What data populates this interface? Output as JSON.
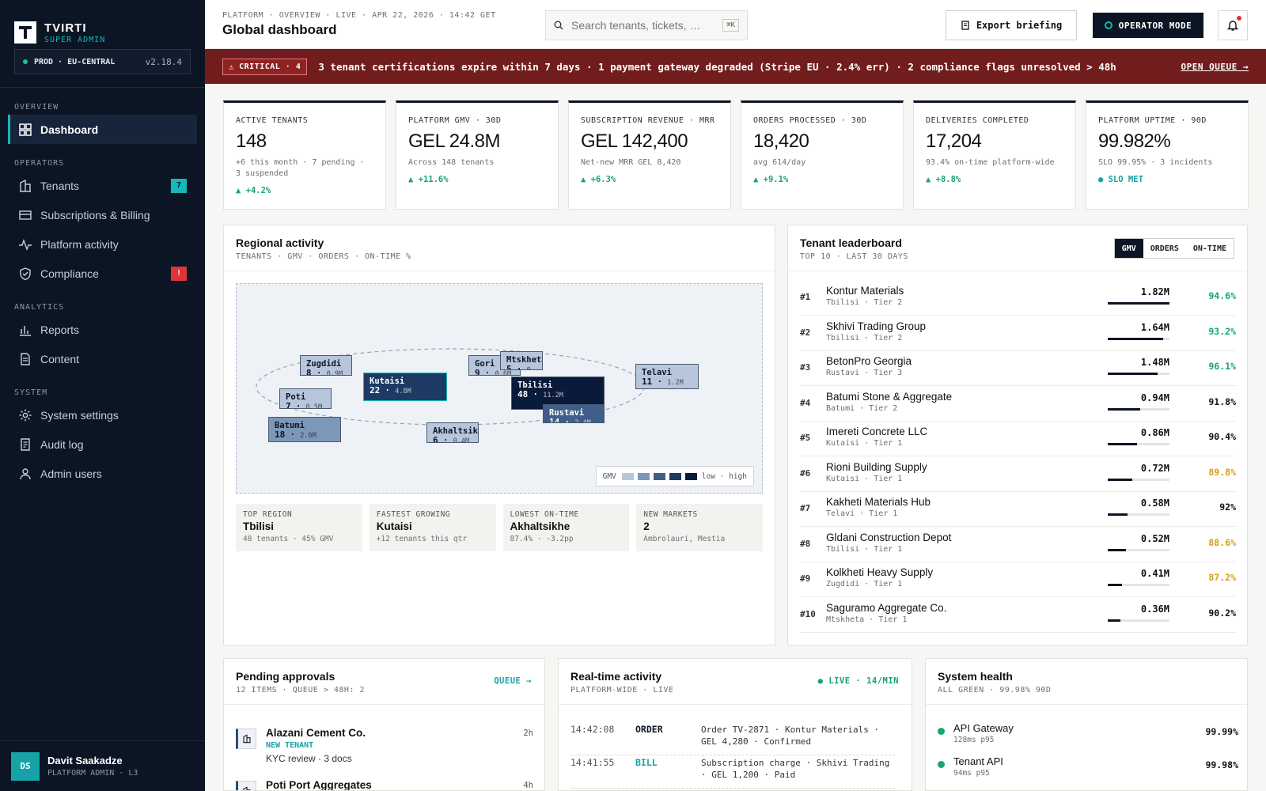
{
  "brand": {
    "name": "TVIRTI",
    "sub": "SUPER ADMIN"
  },
  "env": {
    "label": "PROD · EU-CENTRAL",
    "version": "v2.18.4"
  },
  "sidebar": {
    "sections": [
      {
        "title": "OVERVIEW",
        "items": [
          {
            "label": "Dashboard",
            "icon": "dashboard-icon"
          }
        ]
      },
      {
        "title": "OPERATORS",
        "items": [
          {
            "label": "Tenants",
            "icon": "building-icon",
            "badge": "7"
          },
          {
            "label": "Subscriptions & Billing",
            "icon": "card-icon"
          },
          {
            "label": "Platform activity",
            "icon": "activity-icon"
          },
          {
            "label": "Compliance",
            "icon": "shield-icon",
            "badge": "!"
          }
        ]
      },
      {
        "title": "ANALYTICS",
        "items": [
          {
            "label": "Reports",
            "icon": "bar-chart-icon"
          },
          {
            "label": "Content",
            "icon": "document-icon"
          }
        ]
      },
      {
        "title": "SYSTEM",
        "items": [
          {
            "label": "System settings",
            "icon": "gear-icon"
          },
          {
            "label": "Audit log",
            "icon": "log-icon"
          },
          {
            "label": "Admin users",
            "icon": "user-icon"
          }
        ]
      }
    ]
  },
  "user": {
    "initials": "DS",
    "name": "Davit Saakadze",
    "role": "PLATFORM ADMIN · L3"
  },
  "header": {
    "breadcrumb": "PLATFORM · OVERVIEW · LIVE · APR 22, 2026 · 14:42 GET",
    "title": "Global dashboard",
    "search_placeholder": "Search tenants, tickets, …",
    "search_kbd": "⌘K",
    "export_label": "Export briefing",
    "operator_label": "OPERATOR MODE"
  },
  "alert": {
    "badge": "CRITICAL · 4",
    "message": "3 tenant certifications expire within 7 days · 1 payment gateway degraded (Stripe EU · 2.4% err) · 2 compliance flags unresolved > 48h",
    "action": "OPEN QUEUE →"
  },
  "kpis": [
    {
      "label": "ACTIVE TENANTS",
      "value": "148",
      "sub": "+6 this month · 7 pending · 3 suspended",
      "delta": "▲ +4.2%"
    },
    {
      "label": "PLATFORM GMV · 30D",
      "value": "GEL 24.8M",
      "sub": "Across 148 tenants",
      "delta": "▲ +11.6%"
    },
    {
      "label": "SUBSCRIPTION REVENUE · MRR",
      "value": "GEL 142,400",
      "sub": "Net-new MRR GEL 8,420",
      "delta": "▲ +6.3%"
    },
    {
      "label": "ORDERS PROCESSED · 30D",
      "value": "18,420",
      "sub": "avg 614/day",
      "delta": "▲ +9.1%"
    },
    {
      "label": "DELIVERIES COMPLETED",
      "value": "17,204",
      "sub": "93.4% on-time platform-wide",
      "delta": "▲ +8.8%"
    },
    {
      "label": "PLATFORM UPTIME · 90D",
      "value": "99.982%",
      "sub": "SLO 99.95% · 3 incidents",
      "delta": "● SLO MET"
    }
  ],
  "regional": {
    "title": "Regional activity",
    "subtitle": "TENANTS · GMV · ORDERS · ON-TIME %",
    "legend": {
      "label": "GMV",
      "low": "low",
      "high": "high",
      "colors": [
        "#b7c6da",
        "#7d97b9",
        "#3f5f8a",
        "#1c3a63",
        "#0a1a3a"
      ]
    },
    "regions": [
      {
        "name": "Zugdidi",
        "tenants": "8",
        "gmv": "0.9M",
        "level": 0
      },
      {
        "name": "Poti",
        "tenants": "7",
        "gmv": "0.5M",
        "level": 0
      },
      {
        "name": "Batumi",
        "tenants": "18",
        "gmv": "2.6M",
        "level": 1
      },
      {
        "name": "Kutaisi",
        "tenants": "22",
        "gmv": "4.8M",
        "level": 3
      },
      {
        "name": "Akhaltsikhe",
        "tenants": "6",
        "gmv": "0.4M",
        "level": 0
      },
      {
        "name": "Gori",
        "tenants": "9",
        "gmv": "0.6M",
        "level": 0
      },
      {
        "name": "Mtskheta",
        "tenants": "5",
        "gmv": "0",
        "level": 0
      },
      {
        "name": "Tbilisi",
        "tenants": "48",
        "gmv": "11.2M",
        "level": 4
      },
      {
        "name": "Rustavi",
        "tenants": "14",
        "gmv": "2.4M",
        "level": 2
      },
      {
        "name": "Telavi",
        "tenants": "11",
        "gmv": "1.2M",
        "level": 0
      }
    ],
    "stats": [
      {
        "k": "TOP REGION",
        "v": "Tbilisi",
        "d": "48 tenants · 45% GMV"
      },
      {
        "k": "FASTEST GROWING",
        "v": "Kutaisi",
        "d": "+12 tenants this qtr"
      },
      {
        "k": "LOWEST ON-TIME",
        "v": "Akhaltsikhe",
        "d": "87.4% · -3.2pp"
      },
      {
        "k": "NEW MARKETS",
        "v": "2",
        "d": "Ambrolauri, Mestia"
      }
    ]
  },
  "leaderboard": {
    "title": "Tenant leaderboard",
    "subtitle": "TOP 10 · LAST 30 DAYS",
    "tabs": [
      "GMV",
      "ORDERS",
      "ON-TIME"
    ],
    "rows": [
      {
        "rank": "#1",
        "name": "Kontur Materials",
        "loc": "Tbilisi · Tier 2",
        "gmv": "1.82M",
        "share": 1.0,
        "ontime": "94.6%",
        "color": "#18a46a"
      },
      {
        "rank": "#2",
        "name": "Skhivi Trading Group",
        "loc": "Tbilisi · Tier 2",
        "gmv": "1.64M",
        "share": 0.9,
        "ontime": "93.2%",
        "color": "#18a46a"
      },
      {
        "rank": "#3",
        "name": "BetonPro Georgia",
        "loc": "Rustavi · Tier 3",
        "gmv": "1.48M",
        "share": 0.81,
        "ontime": "96.1%",
        "color": "#18a46a"
      },
      {
        "rank": "#4",
        "name": "Batumi Stone & Aggregate",
        "loc": "Batumi · Tier 2",
        "gmv": "0.94M",
        "share": 0.52,
        "ontime": "91.8%",
        "color": "#111111"
      },
      {
        "rank": "#5",
        "name": "Imereti Concrete LLC",
        "loc": "Kutaisi · Tier 1",
        "gmv": "0.86M",
        "share": 0.47,
        "ontime": "90.4%",
        "color": "#111111"
      },
      {
        "rank": "#6",
        "name": "Rioni Building Supply",
        "loc": "Kutaisi · Tier 1",
        "gmv": "0.72M",
        "share": 0.4,
        "ontime": "89.8%",
        "color": "#d4a017"
      },
      {
        "rank": "#7",
        "name": "Kakheti Materials Hub",
        "loc": "Telavi · Tier 1",
        "gmv": "0.58M",
        "share": 0.32,
        "ontime": "92%",
        "color": "#111111"
      },
      {
        "rank": "#8",
        "name": "Gldani Construction Depot",
        "loc": "Tbilisi · Tier 1",
        "gmv": "0.52M",
        "share": 0.29,
        "ontime": "88.6%",
        "color": "#d4a017"
      },
      {
        "rank": "#9",
        "name": "Kolkheti Heavy Supply",
        "loc": "Zugdidi · Tier 1",
        "gmv": "0.41M",
        "share": 0.23,
        "ontime": "87.2%",
        "color": "#d4a017"
      },
      {
        "rank": "#10",
        "name": "Saguramo Aggregate Co.",
        "loc": "Mtskheta · Tier 1",
        "gmv": "0.36M",
        "share": 0.2,
        "ontime": "90.2%",
        "color": "#111111"
      }
    ]
  },
  "approvals": {
    "title": "Pending approvals",
    "subtitle": "12 ITEMS · QUEUE > 48H: 2",
    "link": "QUEUE →",
    "items": [
      {
        "name": "Alazani Cement Co.",
        "tag": "NEW TENANT",
        "detail": "KYC review · 3 docs",
        "time": "2h"
      },
      {
        "name": "Poti Port Aggregates",
        "time": "4h"
      }
    ]
  },
  "activity": {
    "title": "Real-time activity",
    "subtitle": "PLATFORM-WIDE · LIVE",
    "live": "LIVE · 14/MIN",
    "items": [
      {
        "time": "14:42:08",
        "type": "ORDER",
        "desc": "Order TV-2871 · Kontur Materials · GEL 4,280 · Confirmed",
        "color": "#0c1524"
      },
      {
        "time": "14:41:55",
        "type": "BILL",
        "desc": "Subscription charge · Skhivi Trading · GEL 1,200 · Paid",
        "color": "#16a3a8"
      }
    ]
  },
  "health": {
    "title": "System health",
    "subtitle": "ALL GREEN · 99.98% 90D",
    "items": [
      {
        "name": "API Gateway",
        "metric": "128ms p95",
        "pct": "99.99%"
      },
      {
        "name": "Tenant API",
        "metric": "94ms p95",
        "pct": "99.98%"
      }
    ]
  }
}
